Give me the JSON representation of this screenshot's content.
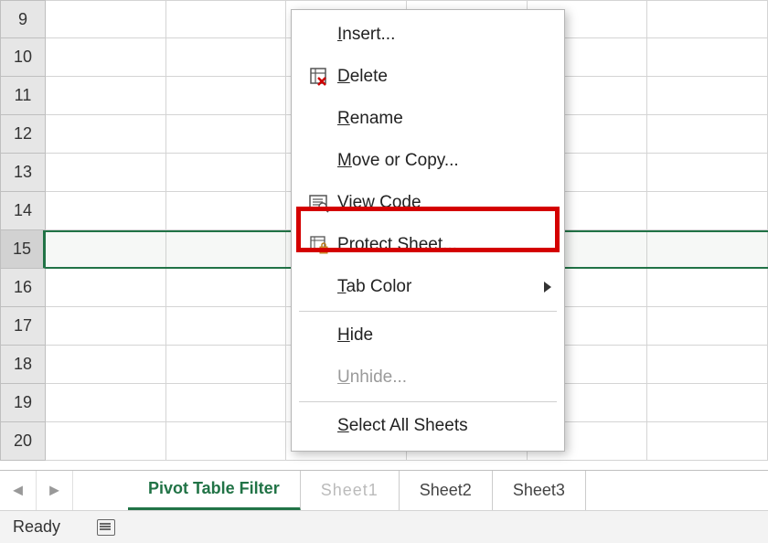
{
  "rows": [
    "9",
    "10",
    "11",
    "12",
    "13",
    "14",
    "15",
    "16",
    "17",
    "18",
    "19",
    "20"
  ],
  "selected_row": "15",
  "context_menu": {
    "insert": "Insert...",
    "delete": "Delete",
    "rename": "Rename",
    "move_copy": "Move or Copy...",
    "view_code": "View Code",
    "protect": "Protect Sheet...",
    "tab_color": "Tab Color",
    "hide": "Hide",
    "unhide": "Unhide...",
    "select_all": "Select All Sheets"
  },
  "tabs": {
    "active": "Pivot Table Filter",
    "obscured": "Sheet1",
    "sheet2": "Sheet2",
    "sheet3": "Sheet3"
  },
  "status": {
    "ready": "Ready"
  },
  "nav": {
    "prev": "◄",
    "next": "►"
  }
}
